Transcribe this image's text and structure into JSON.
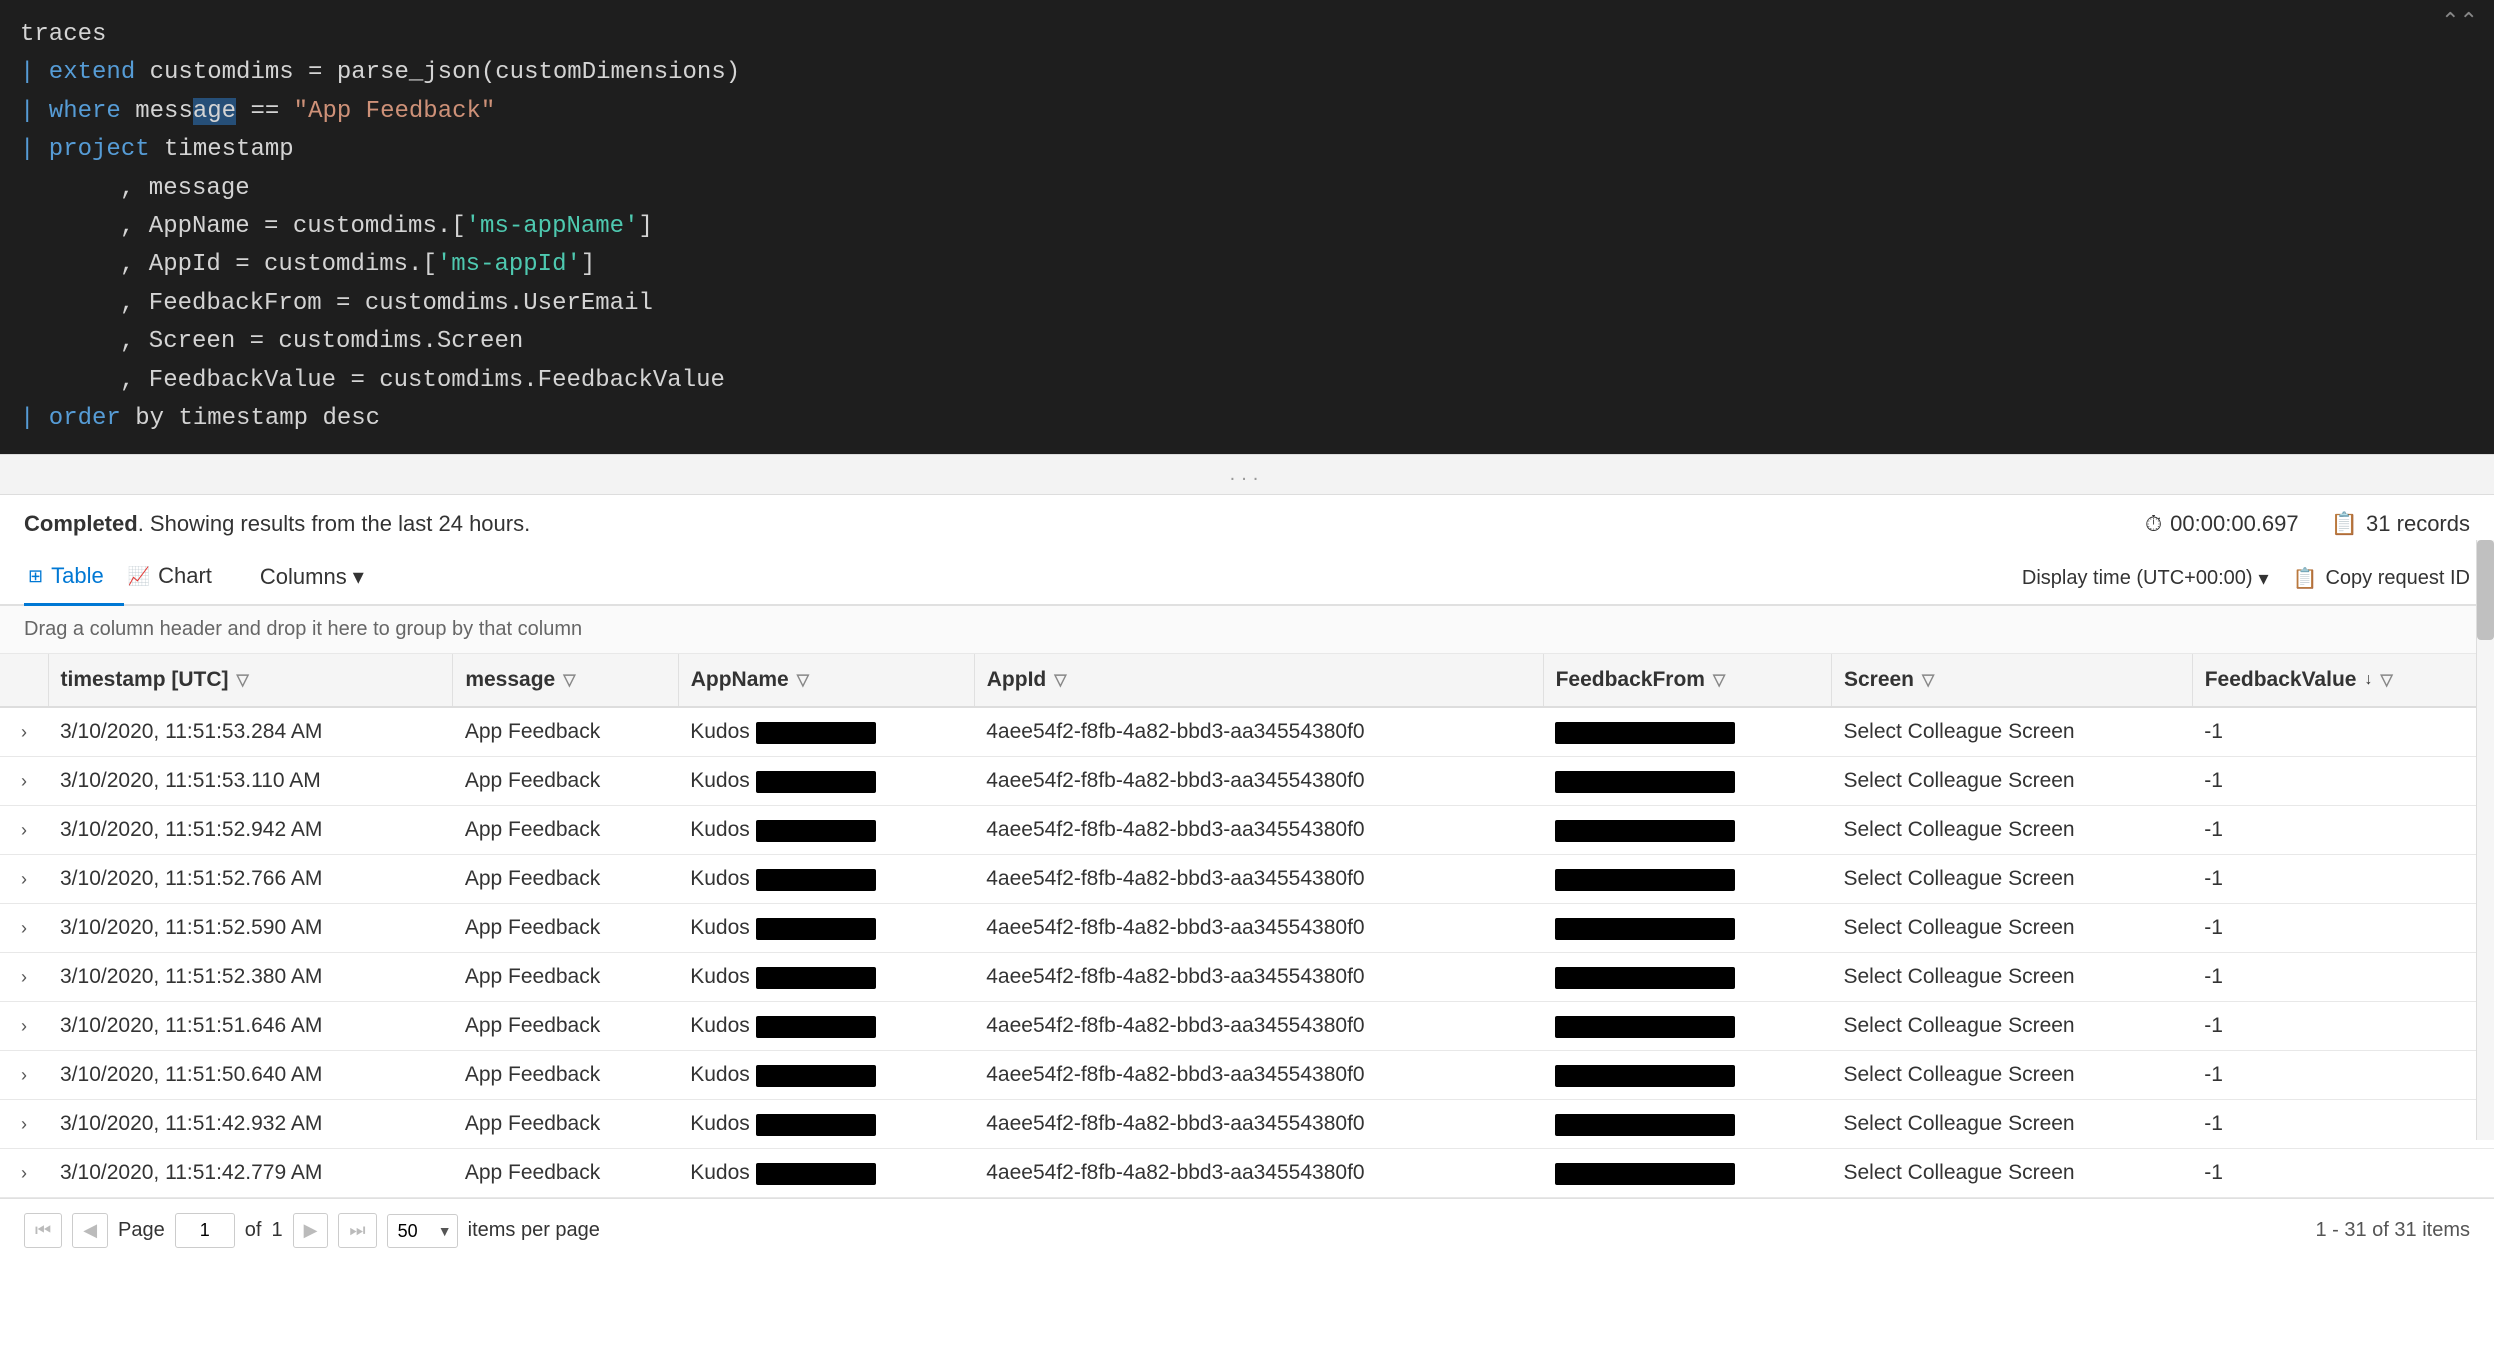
{
  "editor": {
    "lines": [
      {
        "indent": 0,
        "content": "traces"
      },
      {
        "indent": 0,
        "prefix": "| ",
        "kw": "extend",
        "rest": " customdims = parse_json(customDimensions)"
      },
      {
        "indent": 0,
        "prefix": "| ",
        "kw": "where",
        "rest": " mess",
        "cursor": true,
        "rest2": "age == ",
        "string": "\"App Feedback\""
      },
      {
        "indent": 0,
        "prefix": "| ",
        "kw": "project",
        "rest": " timestamp"
      },
      {
        "indent": 3,
        "rest": ", message"
      },
      {
        "indent": 3,
        "rest": ", AppName = customdims.[",
        "bracket1": "'ms-appName'",
        "rest2": "]"
      },
      {
        "indent": 3,
        "rest": ", AppId = customdims.[",
        "bracket2": "'ms-appId'",
        "rest2": "]"
      },
      {
        "indent": 3,
        "rest": ", FeedbackFrom = customdims.UserEmail"
      },
      {
        "indent": 3,
        "rest": ", Screen = customdims.Screen"
      },
      {
        "indent": 3,
        "rest": ", FeedbackValue = customdims.FeedbackValue"
      },
      {
        "indent": 0,
        "prefix": "| ",
        "kw": "order",
        "rest": " by timestamp desc"
      }
    ],
    "collapse_icon": "⌃⌃"
  },
  "divider": {
    "dots": "..."
  },
  "status": {
    "completed_label": "Completed",
    "showing_text": ". Showing results from the last 24 hours.",
    "timer_icon": "⏱",
    "timer_value": "00:00:00.697",
    "records_icon": "📋",
    "records_count": "31 records"
  },
  "toolbar": {
    "table_tab": "Table",
    "chart_tab": "Chart",
    "columns_btn": "Columns",
    "display_time": "Display time (UTC+00:00)",
    "copy_request": "Copy request ID"
  },
  "drag_hint": "Drag a column header and drop it here to group by that column",
  "table": {
    "columns": [
      {
        "id": "expand",
        "label": ""
      },
      {
        "id": "timestamp",
        "label": "timestamp [UTC]",
        "filter": true,
        "sort": false
      },
      {
        "id": "message",
        "label": "message",
        "filter": true,
        "sort": false
      },
      {
        "id": "appname",
        "label": "AppName",
        "filter": true,
        "sort": false
      },
      {
        "id": "appid",
        "label": "AppId",
        "filter": true,
        "sort": false
      },
      {
        "id": "feedbackfrom",
        "label": "FeedbackFrom",
        "filter": true,
        "sort": false
      },
      {
        "id": "screen",
        "label": "Screen",
        "filter": true,
        "sort": false
      },
      {
        "id": "feedbackvalue",
        "label": "FeedbackValue",
        "filter": true,
        "sort": true,
        "sort_dir": "desc"
      }
    ],
    "rows": [
      {
        "timestamp": "3/10/2020, 11:51:53.284 AM",
        "message": "App Feedback",
        "appname": "Kudos",
        "appname_redacted": true,
        "appid": "4aee54f2-f8fb-4a82-bbd3-aa34554380f0",
        "feedbackfrom_redacted": true,
        "screen": "Select Colleague Screen",
        "feedbackvalue": "-1"
      },
      {
        "timestamp": "3/10/2020, 11:51:53.110 AM",
        "message": "App Feedback",
        "appname": "Kudos",
        "appname_redacted": true,
        "appid": "4aee54f2-f8fb-4a82-bbd3-aa34554380f0",
        "feedbackfrom_redacted": true,
        "screen": "Select Colleague Screen",
        "feedbackvalue": "-1"
      },
      {
        "timestamp": "3/10/2020, 11:51:52.942 AM",
        "message": "App Feedback",
        "appname": "Kudos",
        "appname_redacted": true,
        "appid": "4aee54f2-f8fb-4a82-bbd3-aa34554380f0",
        "feedbackfrom_redacted": true,
        "screen": "Select Colleague Screen",
        "feedbackvalue": "-1"
      },
      {
        "timestamp": "3/10/2020, 11:51:52.766 AM",
        "message": "App Feedback",
        "appname": "Kudos",
        "appname_redacted": true,
        "appid": "4aee54f2-f8fb-4a82-bbd3-aa34554380f0",
        "feedbackfrom_redacted": true,
        "screen": "Select Colleague Screen",
        "feedbackvalue": "-1"
      },
      {
        "timestamp": "3/10/2020, 11:51:52.590 AM",
        "message": "App Feedback",
        "appname": "Kudos",
        "appname_redacted": true,
        "appid": "4aee54f2-f8fb-4a82-bbd3-aa34554380f0",
        "feedbackfrom_redacted": true,
        "screen": "Select Colleague Screen",
        "feedbackvalue": "-1"
      },
      {
        "timestamp": "3/10/2020, 11:51:52.380 AM",
        "message": "App Feedback",
        "appname": "Kudos",
        "appname_redacted": true,
        "appid": "4aee54f2-f8fb-4a82-bbd3-aa34554380f0",
        "feedbackfrom_redacted": true,
        "screen": "Select Colleague Screen",
        "feedbackvalue": "-1"
      },
      {
        "timestamp": "3/10/2020, 11:51:51.646 AM",
        "message": "App Feedback",
        "appname": "Kudos",
        "appname_redacted": true,
        "appid": "4aee54f2-f8fb-4a82-bbd3-aa34554380f0",
        "feedbackfrom_redacted": true,
        "screen": "Select Colleague Screen",
        "feedbackvalue": "-1"
      },
      {
        "timestamp": "3/10/2020, 11:51:50.640 AM",
        "message": "App Feedback",
        "appname": "Kudos",
        "appname_redacted": true,
        "appid": "4aee54f2-f8fb-4a82-bbd3-aa34554380f0",
        "feedbackfrom_redacted": true,
        "screen": "Select Colleague Screen",
        "feedbackvalue": "-1"
      },
      {
        "timestamp": "3/10/2020, 11:51:42.932 AM",
        "message": "App Feedback",
        "appname": "Kudos",
        "appname_redacted": true,
        "appid": "4aee54f2-f8fb-4a82-bbd3-aa34554380f0",
        "feedbackfrom_redacted": true,
        "screen": "Select Colleague Screen",
        "feedbackvalue": "-1"
      },
      {
        "timestamp": "3/10/2020, 11:51:42.779 AM",
        "message": "App Feedback",
        "appname": "Kudos",
        "appname_redacted": true,
        "appid": "4aee54f2-f8fb-4a82-bbd3-aa34554380f0",
        "feedbackfrom_redacted": true,
        "screen": "Select Colleague Screen",
        "feedbackvalue": "-1"
      }
    ]
  },
  "pagination": {
    "page_label": "Page",
    "page_current": "1",
    "of_label": "of",
    "of_value": "1",
    "items_per_page_label": "items per page",
    "items_per_page_value": "50",
    "summary": "1 - 31 of 31 items",
    "first_icon": "⏮",
    "prev_icon": "◀",
    "next_icon": "▶",
    "last_icon": "⏭"
  },
  "colors": {
    "accent_blue": "#0078d4",
    "keyword_blue": "#569cd6",
    "string_red": "#ce9178",
    "bracket_teal": "#4ec9b0"
  }
}
